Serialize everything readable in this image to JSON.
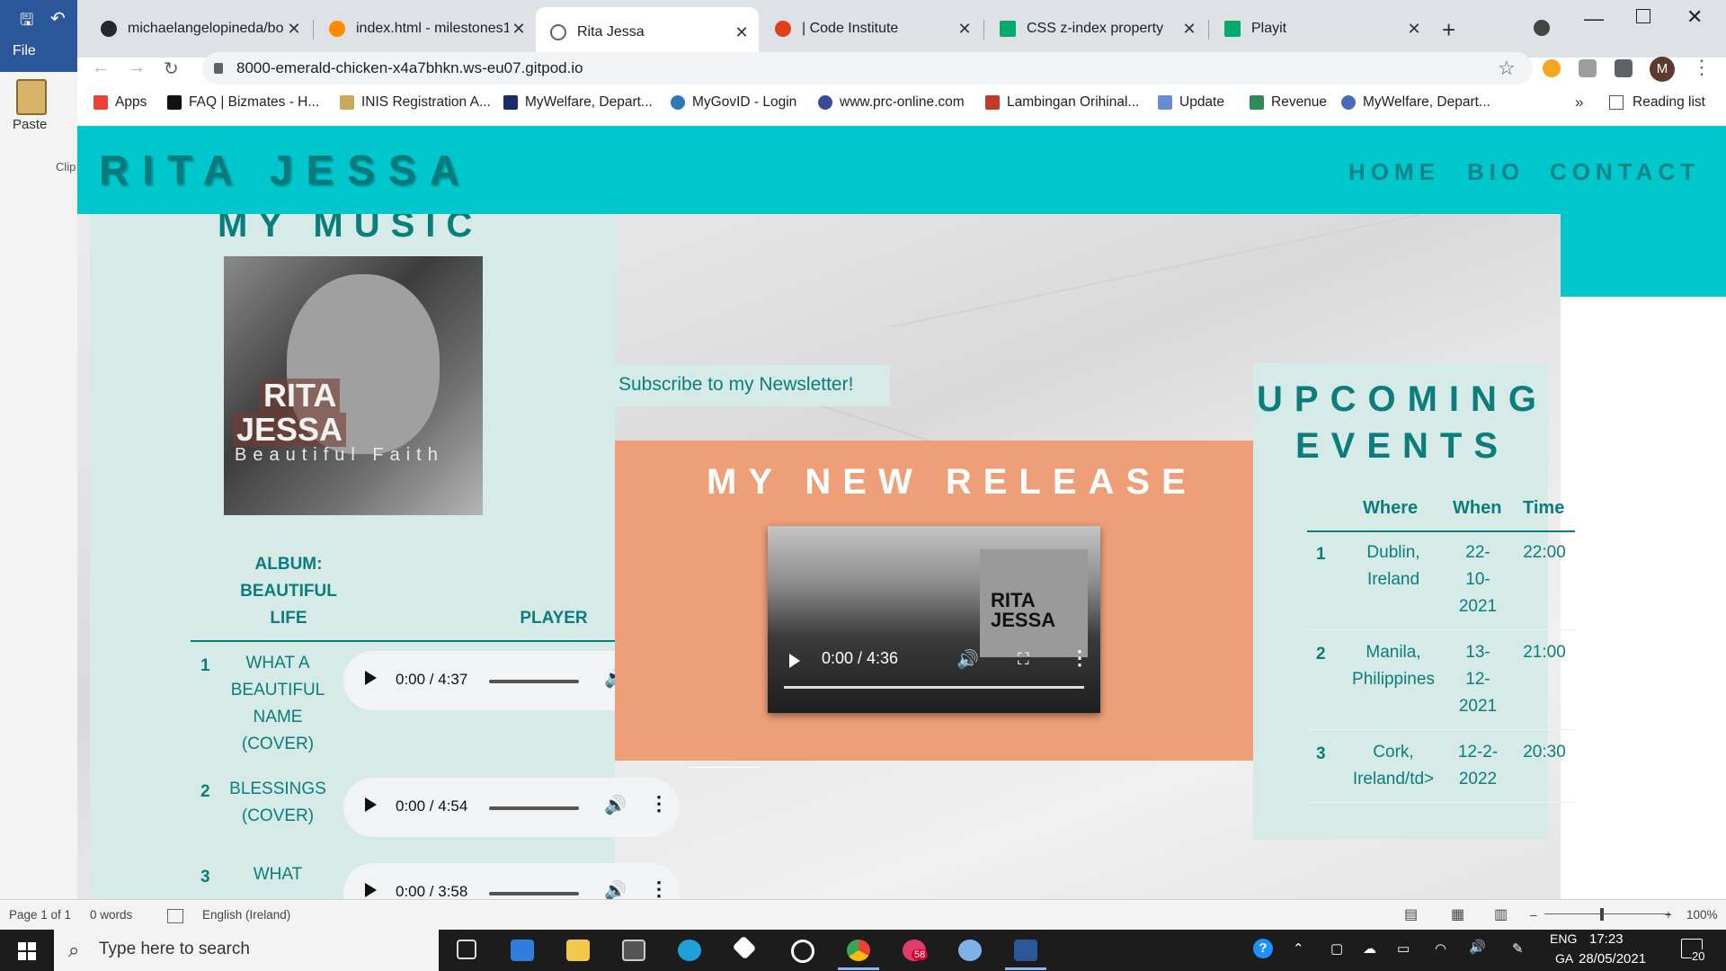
{
  "word": {
    "file_label": "File",
    "paste_label": "Paste",
    "clipboard_label": "Clip",
    "status": {
      "page": "Page 1 of 1",
      "words": "0 words",
      "language": "English (Ireland)",
      "zoom": "100%"
    }
  },
  "browser": {
    "tabs": [
      {
        "title": "michaelangelopineda/bo",
        "icon": "github-icon",
        "color": "#24292e"
      },
      {
        "title": "index.html - milestones1-",
        "icon": "gitpod-icon",
        "color": "#ff8a00"
      },
      {
        "title": "Rita Jessa",
        "icon": "globe-icon",
        "color": "#5f6368",
        "active": true
      },
      {
        "title": "| Code Institute",
        "icon": "code-institute-icon",
        "color": "#e0401c"
      },
      {
        "title": "CSS z-index property",
        "icon": "w3schools-icon",
        "color": "#04aa6d"
      },
      {
        "title": "Playit",
        "icon": "w3schools-icon",
        "color": "#04aa6d"
      }
    ],
    "url": "8000-emerald-chicken-x4a7bhkn.ws-eu07.gitpod.io",
    "profile_initial": "M",
    "bookmarks": [
      {
        "label": "Apps",
        "color": "#ea4335"
      },
      {
        "label": "FAQ | Bizmates - H...",
        "color": "#111111"
      },
      {
        "label": "INIS Registration A...",
        "color": "#c8a85a"
      },
      {
        "label": "MyWelfare, Depart...",
        "color": "#1b2a6b"
      },
      {
        "label": "MyGovID - Login",
        "color": "#2a7ab8"
      },
      {
        "label": "www.prc-online.com",
        "color": "#3a4a9a"
      },
      {
        "label": "Lambingan Orihinal...",
        "color": "#c0392b"
      },
      {
        "label": "Update",
        "color": "#6a8bd0"
      },
      {
        "label": "Revenue",
        "color": "#2e8b57"
      },
      {
        "label": "MyWelfare, Depart...",
        "color": "#4a6ab8"
      }
    ],
    "reading_list": "Reading list"
  },
  "site": {
    "logo": "RITA JESSA",
    "nav": [
      "HOME",
      "BIO",
      "CONTACT"
    ],
    "music": {
      "title": "MY MUSIC",
      "album_art": {
        "line1": "RITA",
        "line2": "JESSA",
        "subtitle": "Beautiful Faith"
      },
      "header_album": [
        "ALBUM:",
        "BEAUTIFUL",
        "LIFE"
      ],
      "header_player": "PLAYER",
      "tracks": [
        {
          "num": "1",
          "name": [
            "WHAT A",
            "BEAUTIFUL",
            "NAME",
            "(COVER)"
          ],
          "time": "0:00 / 4:37"
        },
        {
          "num": "2",
          "name": [
            "BLESSINGS",
            "(COVER)"
          ],
          "time": "0:00 / 4:54"
        },
        {
          "num": "3",
          "name": [
            "WHAT"
          ],
          "time": "0:00 / 3:58"
        }
      ]
    },
    "newsletter": "Subscribe to my Newsletter!",
    "release": {
      "title": "MY NEW RELEASE",
      "video_time": "0:00 / 4:36",
      "video_logo": [
        "RITA",
        "JESSA"
      ]
    },
    "events": {
      "title": [
        "UPCOMING",
        "EVENTS"
      ],
      "headers": [
        "Where",
        "When",
        "Time"
      ],
      "rows": [
        {
          "num": "1",
          "where": [
            "Dublin,",
            "Ireland"
          ],
          "when": [
            "22-",
            "10-",
            "2021"
          ],
          "time": "22:00"
        },
        {
          "num": "2",
          "where": [
            "Manila,",
            "Philippines"
          ],
          "when": [
            "13-",
            "12-",
            "2021"
          ],
          "time": "21:00"
        },
        {
          "num": "3",
          "where": [
            "Cork,",
            "Ireland/td>"
          ],
          "when": [
            "12-2-",
            "2022"
          ],
          "time": "20:30"
        }
      ]
    }
  },
  "taskbar": {
    "search_placeholder": "Type here to search",
    "badge_count": "58",
    "lang_top": "ENG",
    "lang_bottom": "GA",
    "time": "17:23",
    "date": "28/05/2021",
    "notification_count": "20"
  }
}
